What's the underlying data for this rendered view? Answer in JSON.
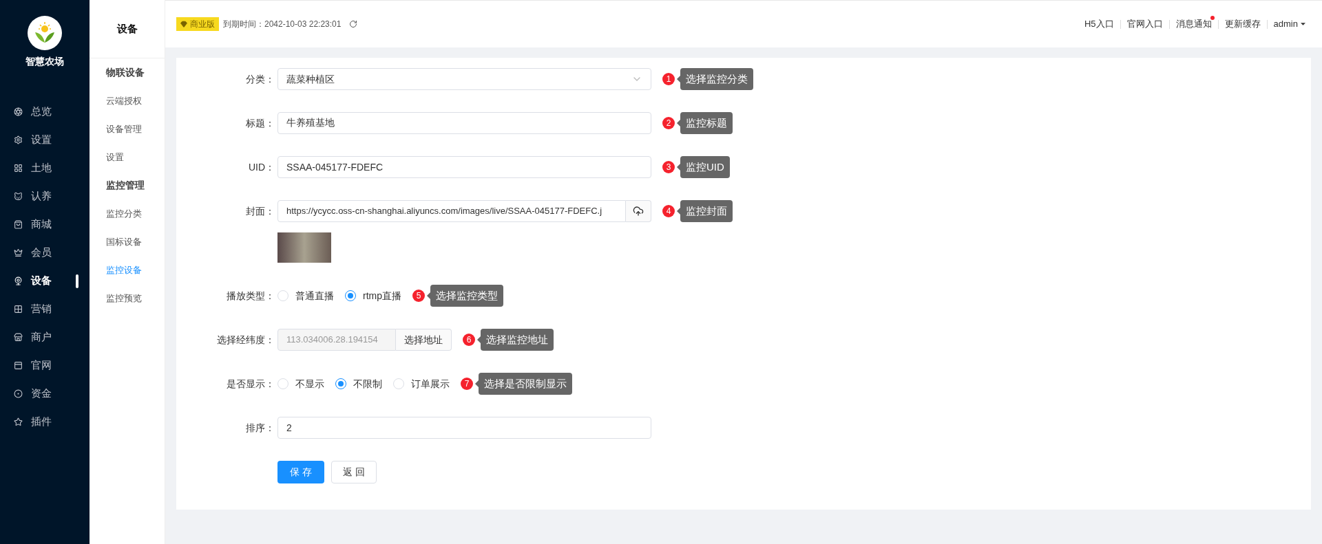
{
  "brand": {
    "name": "智慧农场"
  },
  "nav": [
    {
      "label": "总览",
      "selected": false
    },
    {
      "label": "设置",
      "selected": false
    },
    {
      "label": "土地",
      "selected": false
    },
    {
      "label": "认养",
      "selected": false
    },
    {
      "label": "商城",
      "selected": false
    },
    {
      "label": "会员",
      "selected": false
    },
    {
      "label": "设备",
      "selected": true
    },
    {
      "label": "营销",
      "selected": false
    },
    {
      "label": "商户",
      "selected": false
    },
    {
      "label": "官网",
      "selected": false
    },
    {
      "label": "资金",
      "selected": false
    },
    {
      "label": "插件",
      "selected": false
    }
  ],
  "subnav": {
    "title": "设备",
    "groups": [
      {
        "title": "物联设备",
        "items": [
          {
            "label": "云端授权",
            "selected": false
          },
          {
            "label": "设备管理",
            "selected": false
          },
          {
            "label": "设置",
            "selected": false
          }
        ]
      },
      {
        "title": "监控管理",
        "items": [
          {
            "label": "监控分类",
            "selected": false
          },
          {
            "label": "国标设备",
            "selected": false
          },
          {
            "label": "监控设备",
            "selected": true
          },
          {
            "label": "监控预览",
            "selected": false
          }
        ]
      }
    ]
  },
  "topbar": {
    "edition": "商业版",
    "expiry": "到期时间：2042-10-03 22:23:01",
    "links": [
      {
        "label": "H5入口",
        "notify": false
      },
      {
        "label": "官网入口",
        "notify": false
      },
      {
        "label": "消息通知",
        "notify": true
      },
      {
        "label": "更新缓存",
        "notify": false
      }
    ],
    "user": "admin"
  },
  "form": {
    "fields": [
      {
        "kind": "select",
        "label": "分类：",
        "value": "蔬菜种植区",
        "hint": {
          "number": "1",
          "text": "选择监控分类"
        }
      },
      {
        "kind": "text",
        "label": "标题：",
        "value": "牛养殖基地",
        "hint": {
          "number": "2",
          "text": "监控标题"
        }
      },
      {
        "kind": "text",
        "label": "UID：",
        "value": "SSAA-045177-FDEFC",
        "hint": {
          "number": "3",
          "text": "监控UID"
        }
      },
      {
        "kind": "upload",
        "label": "封面：",
        "value": "https://ycycc.oss-cn-shanghai.aliyuncs.com/images/live/SSAA-045177-FDEFC.j",
        "hint": {
          "number": "4",
          "text": "监控封面"
        }
      },
      {
        "kind": "radio",
        "label": "播放类型：",
        "options": [
          {
            "label": "普通直播",
            "selected": false
          },
          {
            "label": "rtmp直播",
            "selected": true
          }
        ],
        "hint": {
          "number": "5",
          "text": "选择监控类型"
        }
      },
      {
        "kind": "location",
        "label": "选择经纬度：",
        "value": "113.034006.28.194154",
        "button": "选择地址",
        "hint": {
          "number": "6",
          "text": "选择监控地址"
        }
      },
      {
        "kind": "radio",
        "label": "是否显示：",
        "options": [
          {
            "label": "不显示",
            "selected": false
          },
          {
            "label": "不限制",
            "selected": true
          },
          {
            "label": "订单展示",
            "selected": false
          }
        ],
        "hint": {
          "number": "7",
          "text": "选择是否限制显示"
        }
      },
      {
        "kind": "text",
        "label": "排序：",
        "value": "2"
      }
    ],
    "buttons": [
      {
        "label": "保 存",
        "kind": "primary"
      },
      {
        "label": "返 回",
        "kind": "default"
      }
    ]
  }
}
